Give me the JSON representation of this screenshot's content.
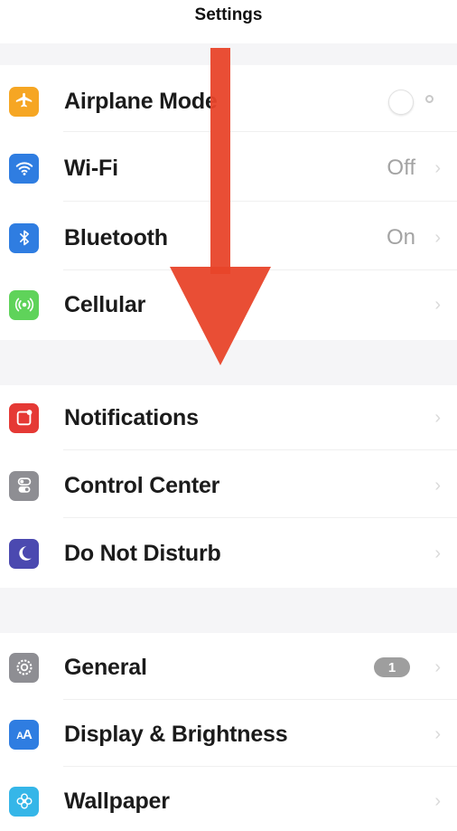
{
  "header": {
    "title": "Settings"
  },
  "rows": [
    {
      "label": "Airplane Mode",
      "value": "",
      "icon": "airplane-icon",
      "color": "#f6a623"
    },
    {
      "label": "Wi-Fi",
      "value": "Off",
      "icon": "wifi-icon",
      "color": "#2f7de1"
    },
    {
      "label": "Bluetooth",
      "value": "On",
      "icon": "bluetooth-icon",
      "color": "#2f7de1"
    },
    {
      "label": "Cellular",
      "value": "",
      "icon": "cellular-icon",
      "color": "#5fd35a"
    },
    {
      "label": "Notifications",
      "value": "",
      "icon": "notifications-icon",
      "color": "#e53935"
    },
    {
      "label": "Control Center",
      "value": "",
      "icon": "control-center-icon",
      "color": "#8e8e93"
    },
    {
      "label": "Do Not Disturb",
      "value": "",
      "icon": "moon-icon",
      "color": "#4b49b0"
    },
    {
      "label": "General",
      "value": "",
      "badge": "1",
      "icon": "gear-icon",
      "color": "#8e8e93"
    },
    {
      "label": "Display & Brightness",
      "value": "",
      "icon": "display-brightness-icon",
      "color": "#2f7de1"
    },
    {
      "label": "Wallpaper",
      "value": "",
      "icon": "wallpaper-icon",
      "color": "#35b6e8"
    }
  ],
  "airplane_toggle": {
    "state": "off"
  },
  "annotation": {
    "arrow_color": "#e8452a",
    "direction": "down"
  }
}
